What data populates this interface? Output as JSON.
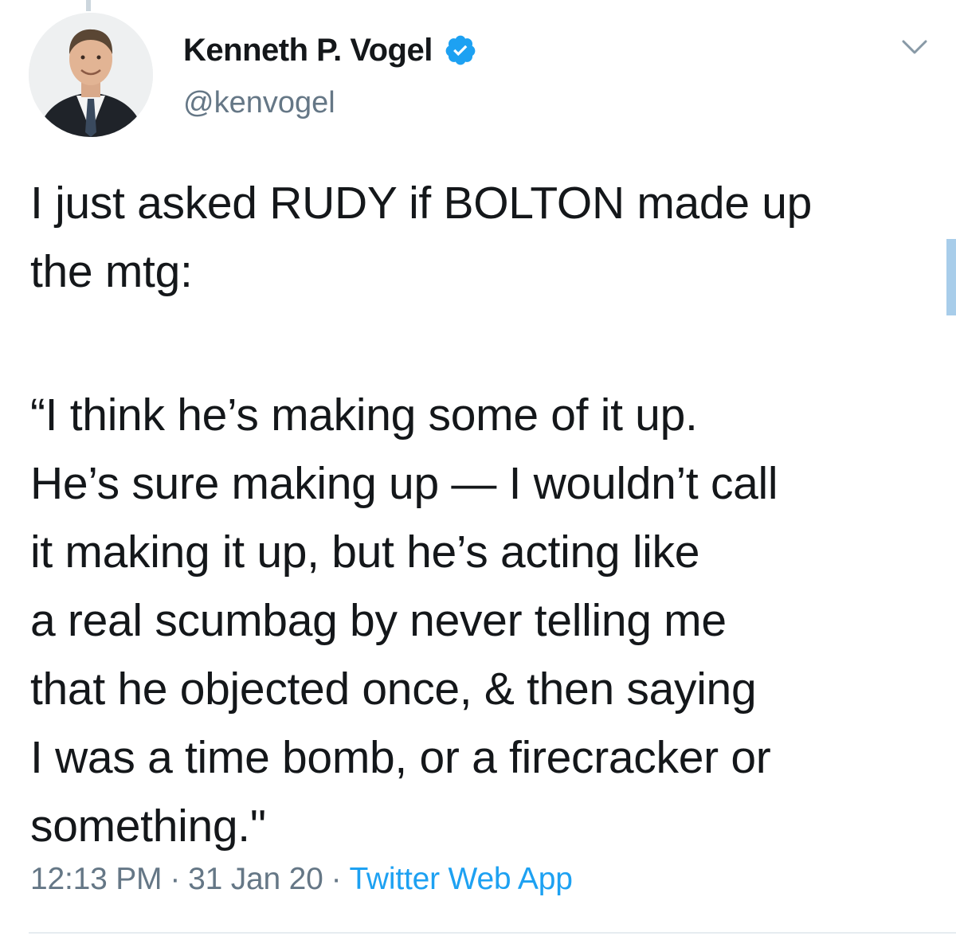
{
  "tweet": {
    "author": {
      "display_name": "Kenneth P. Vogel",
      "handle": "@kenvogel",
      "verified": true
    },
    "text_lines": [
      "I just asked RUDY if BOLTON made up",
      "the mtg:",
      "",
      "“I think he’s making some of it up.",
      "He’s sure making up — I wouldn’t call",
      "it making it up, but he’s acting like",
      "a real scumbag by never telling me",
      "that he objected once, & then saying",
      "I was a time bomb, or a firecracker or",
      "something.\""
    ],
    "time": "12:13 PM",
    "date": "31 Jan 20",
    "source": "Twitter Web App",
    "separator": "·"
  },
  "icons": {
    "verified": "verified-badge-icon",
    "caret": "chevron-down-icon"
  },
  "colors": {
    "accent": "#1da1f2",
    "secondary_text": "#657786",
    "primary_text": "#14171a"
  }
}
